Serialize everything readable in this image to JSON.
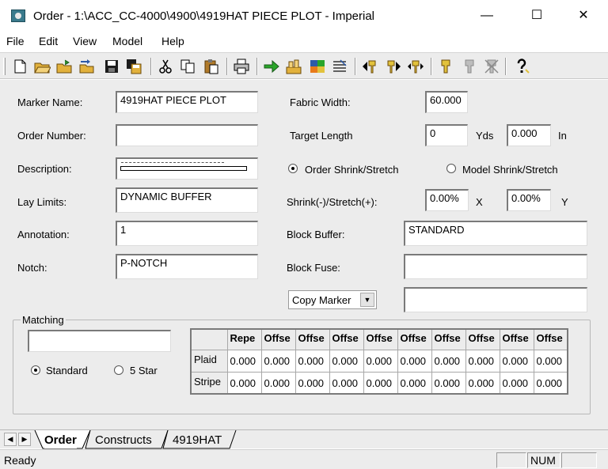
{
  "window": {
    "title": "Order - 1:\\ACC_CC-4000\\4900\\4919HAT PIECE PLOT - Imperial",
    "minimize": "—",
    "maximize": "☐",
    "close": "✕"
  },
  "menu": [
    "File",
    "Edit",
    "View",
    "Model",
    "Help"
  ],
  "toolbar": {
    "icons": [
      "new-icon",
      "open-icon",
      "open-folder-icon",
      "export-icon",
      "save-icon",
      "save-all-icon",
      "cut-icon",
      "copy-icon",
      "paste-icon",
      "print-icon",
      "run-icon",
      "plot-icon",
      "palette-icon",
      "list-icon",
      "arrow-left-icon",
      "arrow-right-icon",
      "arrow-both-icon",
      "piece-icon",
      "piece-disabled-icon",
      "piece-x-icon",
      "help-icon"
    ]
  },
  "form": {
    "marker_name": {
      "label": "Marker Name:",
      "value": "4919HAT PIECE PLOT"
    },
    "order_number": {
      "label": "Order Number:",
      "value": ""
    },
    "description": {
      "label": "Description:",
      "value": ""
    },
    "lay_limits": {
      "label": "Lay Limits:",
      "value": "DYNAMIC BUFFER"
    },
    "annotation": {
      "label": "Annotation:",
      "value": "1"
    },
    "notch": {
      "label": "Notch:",
      "value": "P-NOTCH"
    },
    "fabric_width": {
      "label": "Fabric Width:",
      "value": "60.000"
    },
    "target_length": {
      "label": "Target Length",
      "yds_value": "0",
      "yds_unit": "Yds",
      "in_value": "0.000",
      "in_unit": "In"
    },
    "shrink_mode": {
      "order": "Order Shrink/Stretch",
      "model": "Model Shrink/Stretch",
      "selected": "order"
    },
    "shrink_stretch": {
      "label": "Shrink(-)/Stretch(+):",
      "x_value": "0.00%",
      "x_unit": "X",
      "y_value": "0.00%",
      "y_unit": "Y"
    },
    "block_buffer": {
      "label": "Block Buffer:",
      "value": "STANDARD"
    },
    "block_fuse": {
      "label": "Block Fuse:",
      "value": ""
    },
    "copy_marker": {
      "value": "Copy Marker",
      "extra": ""
    }
  },
  "matching": {
    "title": "Matching",
    "input_value": "",
    "standard": "Standard",
    "five_star": "5 Star",
    "selected": "standard",
    "grid": {
      "columns": [
        "Repe",
        "Offse",
        "Offse",
        "Offse",
        "Offse",
        "Offse",
        "Offse",
        "Offse",
        "Offse",
        "Offse"
      ],
      "rows": [
        {
          "name": "Plaid",
          "values": [
            "0.000",
            "0.000",
            "0.000",
            "0.000",
            "0.000",
            "0.000",
            "0.000",
            "0.000",
            "0.000",
            "0.000"
          ]
        },
        {
          "name": "Stripe",
          "values": [
            "0.000",
            "0.000",
            "0.000",
            "0.000",
            "0.000",
            "0.000",
            "0.000",
            "0.000",
            "0.000",
            "0.000"
          ]
        }
      ]
    }
  },
  "tabs": [
    "Order",
    "Constructs",
    "4919HAT"
  ],
  "status": {
    "text": "Ready",
    "num": "NUM"
  }
}
